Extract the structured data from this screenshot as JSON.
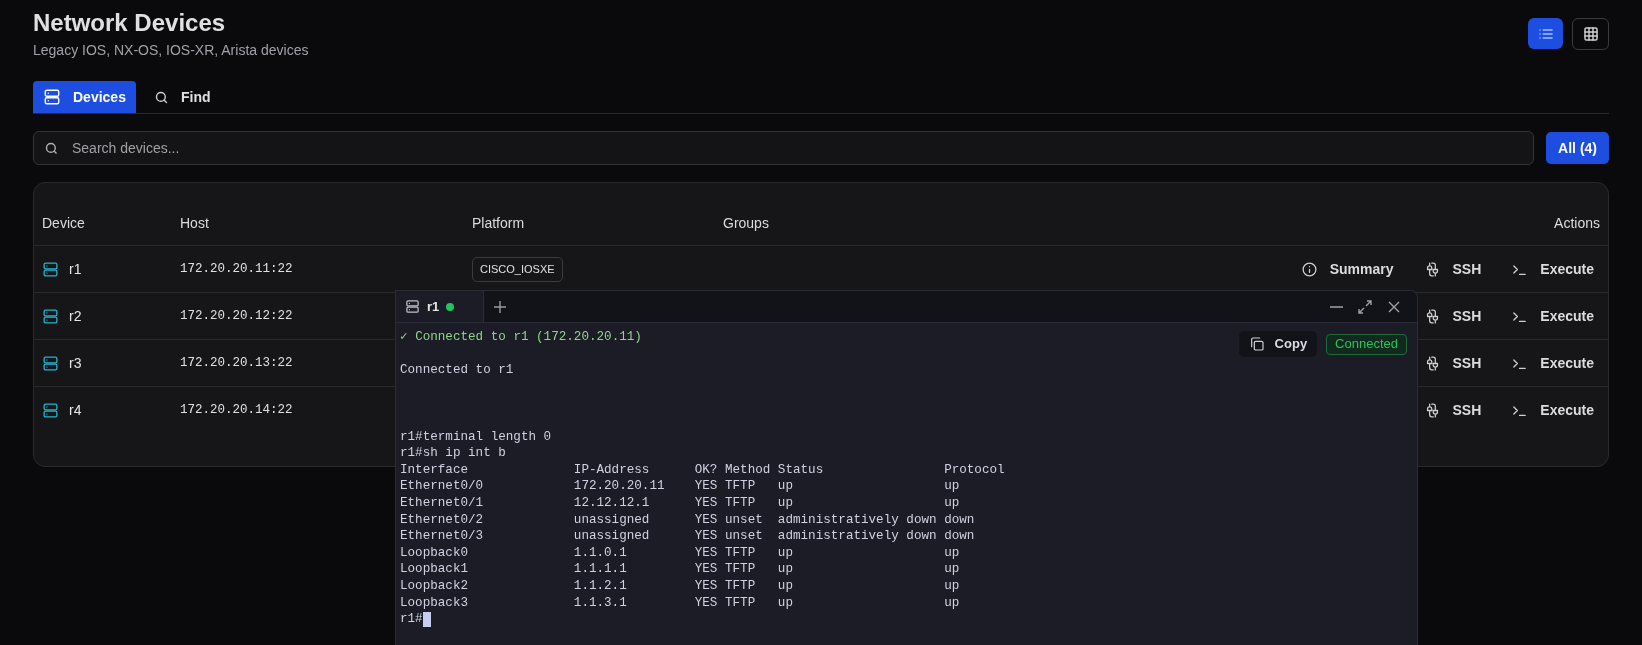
{
  "header": {
    "title": "Network Devices",
    "subtitle": "Legacy IOS, NX-OS, IOS-XR, Arista devices"
  },
  "view_toggle": [
    {
      "kind": "list",
      "selected": true
    },
    {
      "kind": "grid",
      "selected": false
    }
  ],
  "tabs": [
    {
      "kind": "devices",
      "label": "Devices",
      "selected": true
    },
    {
      "kind": "find",
      "label": "Find",
      "selected": false
    }
  ],
  "search": {
    "placeholder": "Search devices..."
  },
  "filter_button": "All (4)",
  "table": {
    "columns": [
      "Device",
      "Host",
      "Platform",
      "Groups",
      "Actions"
    ],
    "rows": [
      {
        "device": "r1",
        "host": "172.20.20.11:22",
        "platform": "CISCO_IOSXE",
        "actions": [
          {
            "kind": "summary",
            "label": "Summary"
          },
          {
            "kind": "ssh",
            "label": "SSH"
          },
          {
            "kind": "execute",
            "label": "Execute"
          }
        ]
      },
      {
        "device": "r2",
        "host": "172.20.20.12:22",
        "actions": [
          {
            "kind": "ssh",
            "label": "SSH"
          },
          {
            "kind": "execute",
            "label": "Execute"
          }
        ]
      },
      {
        "device": "r3",
        "host": "172.20.20.13:22",
        "actions": [
          {
            "kind": "ssh",
            "label": "SSH"
          },
          {
            "kind": "execute",
            "label": "Execute"
          }
        ]
      },
      {
        "device": "r4",
        "host": "172.20.20.14:22",
        "actions": [
          {
            "kind": "ssh",
            "label": "SSH"
          },
          {
            "kind": "execute",
            "label": "Execute"
          }
        ]
      }
    ]
  },
  "terminal": {
    "tabs": [
      {
        "label": "r1",
        "connected": true,
        "selected": true
      }
    ],
    "copy_button": "Copy",
    "badge": "Connected",
    "lines": [
      {
        "kind": "success",
        "text": "✓ Connected to r1 (172.20.20.11)"
      },
      {
        "kind": "banner",
        "text": "Connected to r1"
      },
      {
        "kind": "output",
        "text": "r1#terminal length 0"
      },
      {
        "kind": "output",
        "text": "r1#sh ip int b"
      },
      {
        "kind": "output",
        "text": "Interface              IP-Address      OK? Method Status                Protocol"
      },
      {
        "kind": "output",
        "text": "Ethernet0/0            172.20.20.11    YES TFTP   up                    up"
      },
      {
        "kind": "output",
        "text": "Ethernet0/1            12.12.12.1      YES TFTP   up                    up"
      },
      {
        "kind": "output",
        "text": "Ethernet0/2            unassigned      YES unset  administratively down down"
      },
      {
        "kind": "output",
        "text": "Ethernet0/3            unassigned      YES unset  administratively down down"
      },
      {
        "kind": "output",
        "text": "Loopback0              1.1.0.1         YES TFTP   up                    up"
      },
      {
        "kind": "output",
        "text": "Loopback1              1.1.1.1         YES TFTP   up                    up"
      },
      {
        "kind": "output",
        "text": "Loopback2              1.1.2.1         YES TFTP   up                    up"
      },
      {
        "kind": "output",
        "text": "Loopback3              1.1.3.1         YES TFTP   up                    up"
      }
    ],
    "prompt": "r1#"
  }
}
